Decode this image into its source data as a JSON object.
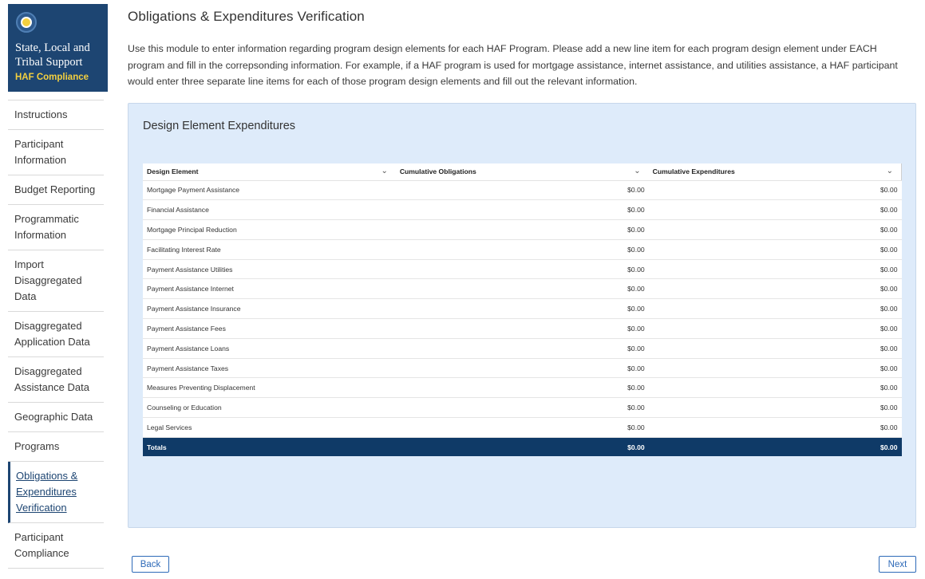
{
  "logo": {
    "icon": "seal-icon",
    "title": "State, Local and Tribal Support",
    "subtitle": "HAF Compliance"
  },
  "sidebar": {
    "items": [
      {
        "label": "Instructions"
      },
      {
        "label": "Participant Information"
      },
      {
        "label": "Budget Reporting"
      },
      {
        "label": "Programmatic Information"
      },
      {
        "label": "Import Disaggregated Data"
      },
      {
        "label": "Disaggregated Application Data"
      },
      {
        "label": "Disaggregated Assistance Data"
      },
      {
        "label": "Geographic Data"
      },
      {
        "label": "Programs"
      },
      {
        "label": "Obligations & Expenditures Verification",
        "active": true
      },
      {
        "label": "Participant Compliance"
      }
    ]
  },
  "main": {
    "title": "Obligations & Expenditures Verification",
    "intro": "Use this module to enter information regarding program design elements for each HAF Program. Please add a new line item for each program design element under EACH program and fill in the correpsonding information. For example, if a HAF program is used for mortgage assistance, internet assistance, and utilities assistance, a HAF participant would enter three separate line items for each of those program design elements and fill out the relevant information."
  },
  "panel": {
    "title": "Design Element Expenditures",
    "columns": [
      "Design Element",
      "Cumulative Obligations",
      "Cumulative Expenditures"
    ],
    "rows": [
      [
        "Mortgage Payment Assistance",
        "$0.00",
        "$0.00"
      ],
      [
        "Financial Assistance",
        "$0.00",
        "$0.00"
      ],
      [
        "Mortgage Principal Reduction",
        "$0.00",
        "$0.00"
      ],
      [
        "Facilitating Interest Rate",
        "$0.00",
        "$0.00"
      ],
      [
        "Payment Assistance Utilities",
        "$0.00",
        "$0.00"
      ],
      [
        "Payment Assistance Internet",
        "$0.00",
        "$0.00"
      ],
      [
        "Payment Assistance Insurance",
        "$0.00",
        "$0.00"
      ],
      [
        "Payment Assistance Fees",
        "$0.00",
        "$0.00"
      ],
      [
        "Payment Assistance Loans",
        "$0.00",
        "$0.00"
      ],
      [
        "Payment Assistance Taxes",
        "$0.00",
        "$0.00"
      ],
      [
        "Measures Preventing Displacement",
        "$0.00",
        "$0.00"
      ],
      [
        "Counseling or Education",
        "$0.00",
        "$0.00"
      ],
      [
        "Legal Services",
        "$0.00",
        "$0.00"
      ]
    ],
    "totals": [
      "Totals",
      "$0.00",
      "$0.00"
    ]
  },
  "buttons": {
    "back": "Back",
    "next": "Next"
  },
  "colors": {
    "brand": "#1d4572",
    "panel_bg": "#deebfa",
    "totals_bg": "#0f3a67",
    "accent": "#f4d03f"
  }
}
